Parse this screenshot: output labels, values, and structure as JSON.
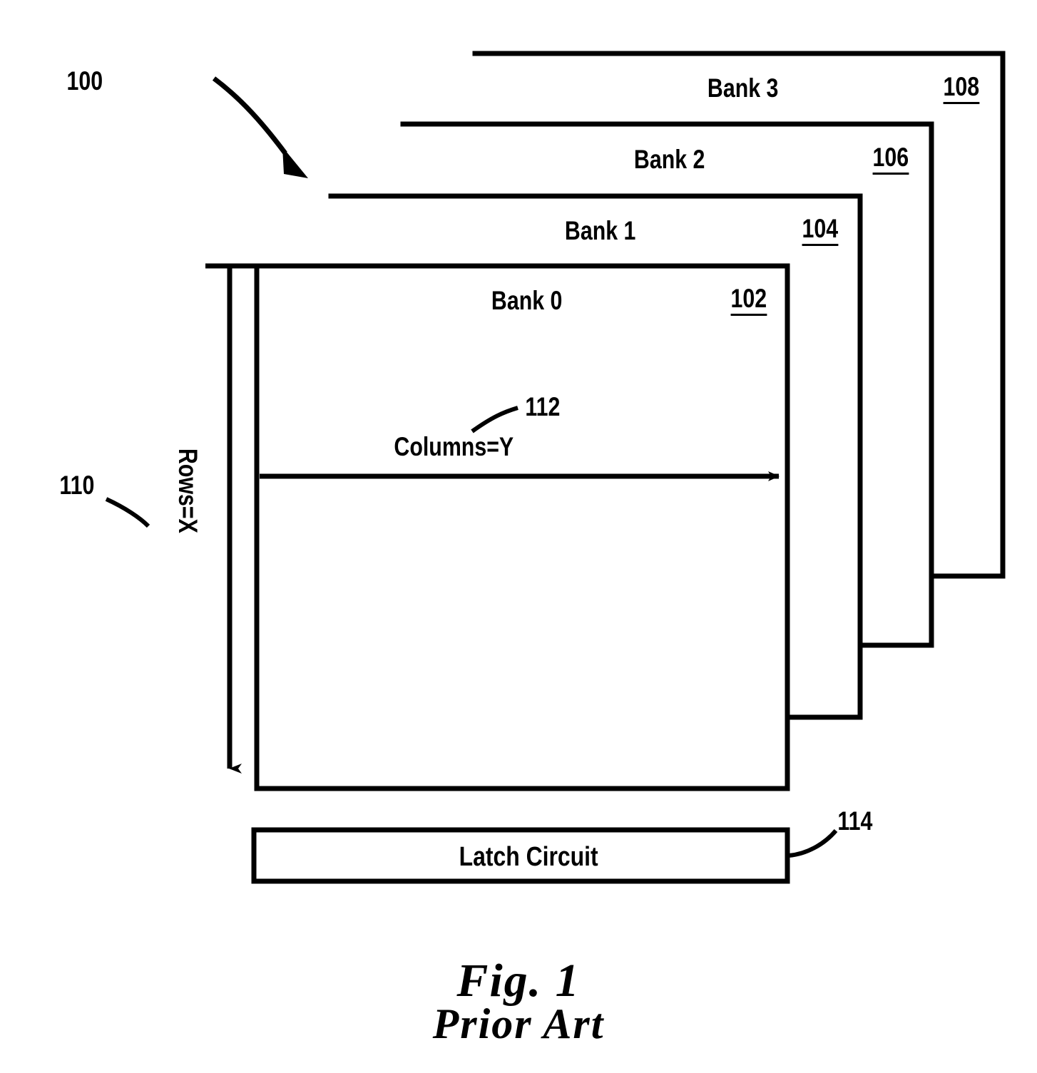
{
  "figure": {
    "assembly_ref": "100",
    "caption_line1": "Fig. 1",
    "caption_line2": "Prior Art"
  },
  "banks": [
    {
      "name": "Bank 3",
      "ref": "108"
    },
    {
      "name": "Bank 2",
      "ref": "106"
    },
    {
      "name": "Bank 1",
      "ref": "104"
    },
    {
      "name": "Bank 0",
      "ref": "102"
    }
  ],
  "axes": {
    "rows_label": "Rows=X",
    "rows_ref": "110",
    "columns_label": "Columns=Y",
    "columns_ref": "112"
  },
  "latch": {
    "label": "Latch Circuit",
    "ref": "114"
  },
  "colors": {
    "ink": "#000000",
    "paper": "#ffffff"
  }
}
